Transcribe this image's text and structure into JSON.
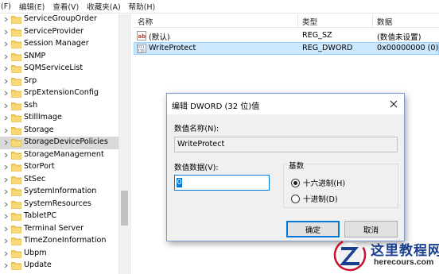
{
  "menubar": {
    "items": [
      "(F)",
      "编辑(E)",
      "查看(V)",
      "收藏夹(A)",
      "帮助(H)"
    ]
  },
  "tree": {
    "selected_index": 11,
    "items": [
      {
        "label": "ServiceGroupOrder"
      },
      {
        "label": "ServiceProvider"
      },
      {
        "label": "Session Manager"
      },
      {
        "label": "SNMP"
      },
      {
        "label": "SQMServiceList"
      },
      {
        "label": "Srp"
      },
      {
        "label": "SrpExtensionConfig"
      },
      {
        "label": "Ssh"
      },
      {
        "label": "StillImage"
      },
      {
        "label": "Storage"
      },
      {
        "label": "StorageDevicePolicies"
      },
      {
        "label": "StorageManagement"
      },
      {
        "label": "StorPort"
      },
      {
        "label": "StSec"
      },
      {
        "label": "SystemInformation"
      },
      {
        "label": "SystemResources"
      },
      {
        "label": "TabletPC"
      },
      {
        "label": "Terminal Server"
      },
      {
        "label": "TimeZoneInformation"
      },
      {
        "label": "Ubpm"
      },
      {
        "label": "Update"
      }
    ]
  },
  "list": {
    "headers": {
      "name": "名称",
      "type": "类型",
      "data": "数据"
    },
    "rows": [
      {
        "icon": "string-value-icon",
        "name": "(默认)",
        "type": "REG_SZ",
        "data": "(数值未设置)",
        "selected": false
      },
      {
        "icon": "dword-value-icon",
        "name": "WriteProtect",
        "type": "REG_DWORD",
        "data": "0x00000000 (0)",
        "selected": true
      }
    ]
  },
  "dialog": {
    "title": "编辑 DWORD (32 位)值",
    "value_name_label": "数值名称(N):",
    "value_name": "WriteProtect",
    "value_data_label": "数值数据(V):",
    "value_data": "0",
    "base_label": "基数",
    "base_options": [
      {
        "label": "十六进制(H)",
        "checked": true
      },
      {
        "label": "十进制(D)",
        "checked": false
      }
    ],
    "ok_label": "确定",
    "cancel_label": "取消"
  },
  "watermark": {
    "title": "这里教程网",
    "subtitle": "herecours.com"
  }
}
